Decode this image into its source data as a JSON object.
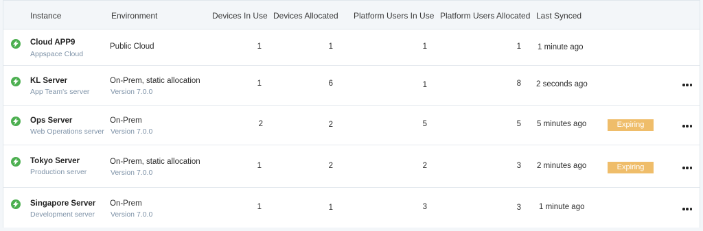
{
  "columns": {
    "instance": "Instance",
    "environment": "Environment",
    "devices_in_use": "Devices In Use",
    "devices_allocated": "Devices Allocated",
    "platform_users_in_use": "Platform Users In Use",
    "platform_users_allocated": "Platform Users Allocated",
    "last_synced": "Last Synced"
  },
  "rows": [
    {
      "name": "Cloud APP9",
      "description": "Appspace Cloud",
      "environment": "Public Cloud",
      "version": "",
      "devices_in_use": "1",
      "devices_allocated": "1",
      "platform_users_in_use": "1",
      "platform_users_allocated": "1",
      "last_synced": "1 minute ago",
      "badge": "",
      "status_icon": "lightning-bolt-icon",
      "status_color": "#4caf50"
    },
    {
      "name": "KL Server",
      "description": "App Team's  server",
      "environment": "On-Prem, static allocation",
      "version": "Version 7.0.0",
      "devices_in_use": "1",
      "devices_allocated": "6",
      "platform_users_in_use": "1",
      "platform_users_allocated": "8",
      "last_synced": "2 seconds ago",
      "badge": "",
      "status_icon": "lightning-bolt-icon",
      "status_color": "#4caf50"
    },
    {
      "name": "Ops Server",
      "description": "Web Operations server",
      "environment": "On-Prem",
      "version": "Version 7.0.0",
      "devices_in_use": "2",
      "devices_allocated": "2",
      "platform_users_in_use": "5",
      "platform_users_allocated": "5",
      "last_synced": "5 minutes ago",
      "badge": "Expiring",
      "status_icon": "lightning-bolt-icon",
      "status_color": "#4caf50"
    },
    {
      "name": "Tokyo Server",
      "description": "Production server",
      "environment": "On-Prem, static allocation",
      "version": "Version 7.0.0",
      "devices_in_use": "1",
      "devices_allocated": "2",
      "platform_users_in_use": "2",
      "platform_users_allocated": "3",
      "last_synced": "2 minutes ago",
      "badge": "Expiring",
      "status_icon": "lightning-bolt-icon",
      "status_color": "#4caf50"
    },
    {
      "name": "Singapore Server",
      "description": "Development  server",
      "environment": "On-Prem",
      "version": "Version 7.0.0",
      "devices_in_use": "1",
      "devices_allocated": "1",
      "platform_users_in_use": "3",
      "platform_users_allocated": "3",
      "last_synced": "1 minute ago",
      "badge": "",
      "status_icon": "lightning-bolt-icon",
      "status_color": "#4caf50"
    }
  ],
  "colors": {
    "badge_expiring": "#efbd6a",
    "status_ok": "#4caf50",
    "subtext": "#7f93a8"
  }
}
